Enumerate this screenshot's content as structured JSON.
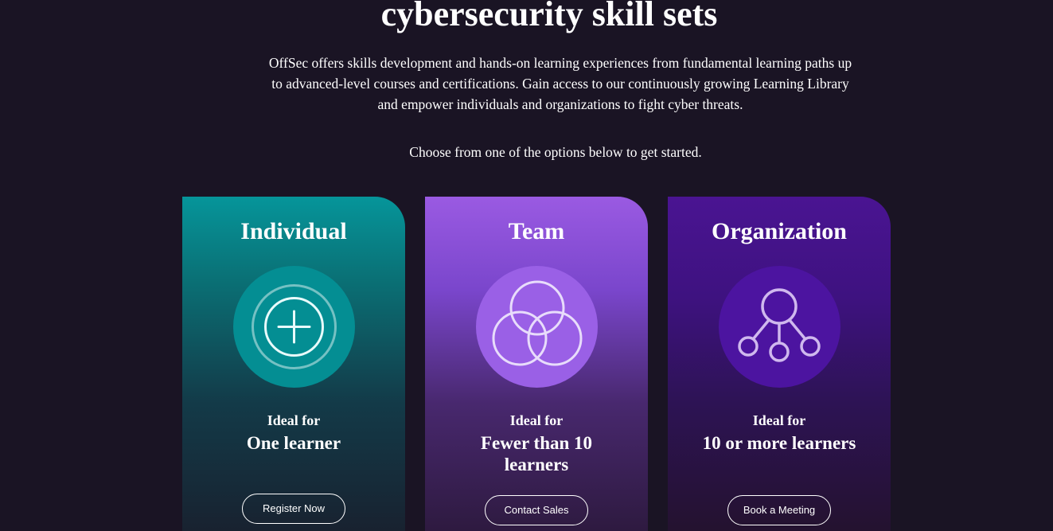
{
  "section": {
    "heading": "cybersecurity skill sets",
    "intro": "OffSec offers skills development and hands-on learning experiences from fundamental learning paths up to advanced-level courses and certifications. Gain access to our continuously growing Learning Library and empower individuals and organizations to fight cyber threats.",
    "choose": "Choose from one of the options below to get started."
  },
  "cards": [
    {
      "title": "Individual",
      "icon": "plus-circle-icon",
      "ideal_label": "Ideal for",
      "audience": "One learner",
      "button": "Register Now",
      "accent": "#048e93"
    },
    {
      "title": "Team",
      "icon": "venn-circles-icon",
      "ideal_label": "Ideal for",
      "audience": "Fewer than 10 learners",
      "button": "Contact Sales",
      "accent": "#9a60e6"
    },
    {
      "title": "Organization",
      "icon": "hierarchy-nodes-icon",
      "ideal_label": "Ideal for",
      "audience": "10 or more learners",
      "button": "Book a Meeting",
      "accent": "#4c14a0"
    }
  ],
  "colors": {
    "page_background": "#1a1424",
    "text": "#ffffff"
  }
}
